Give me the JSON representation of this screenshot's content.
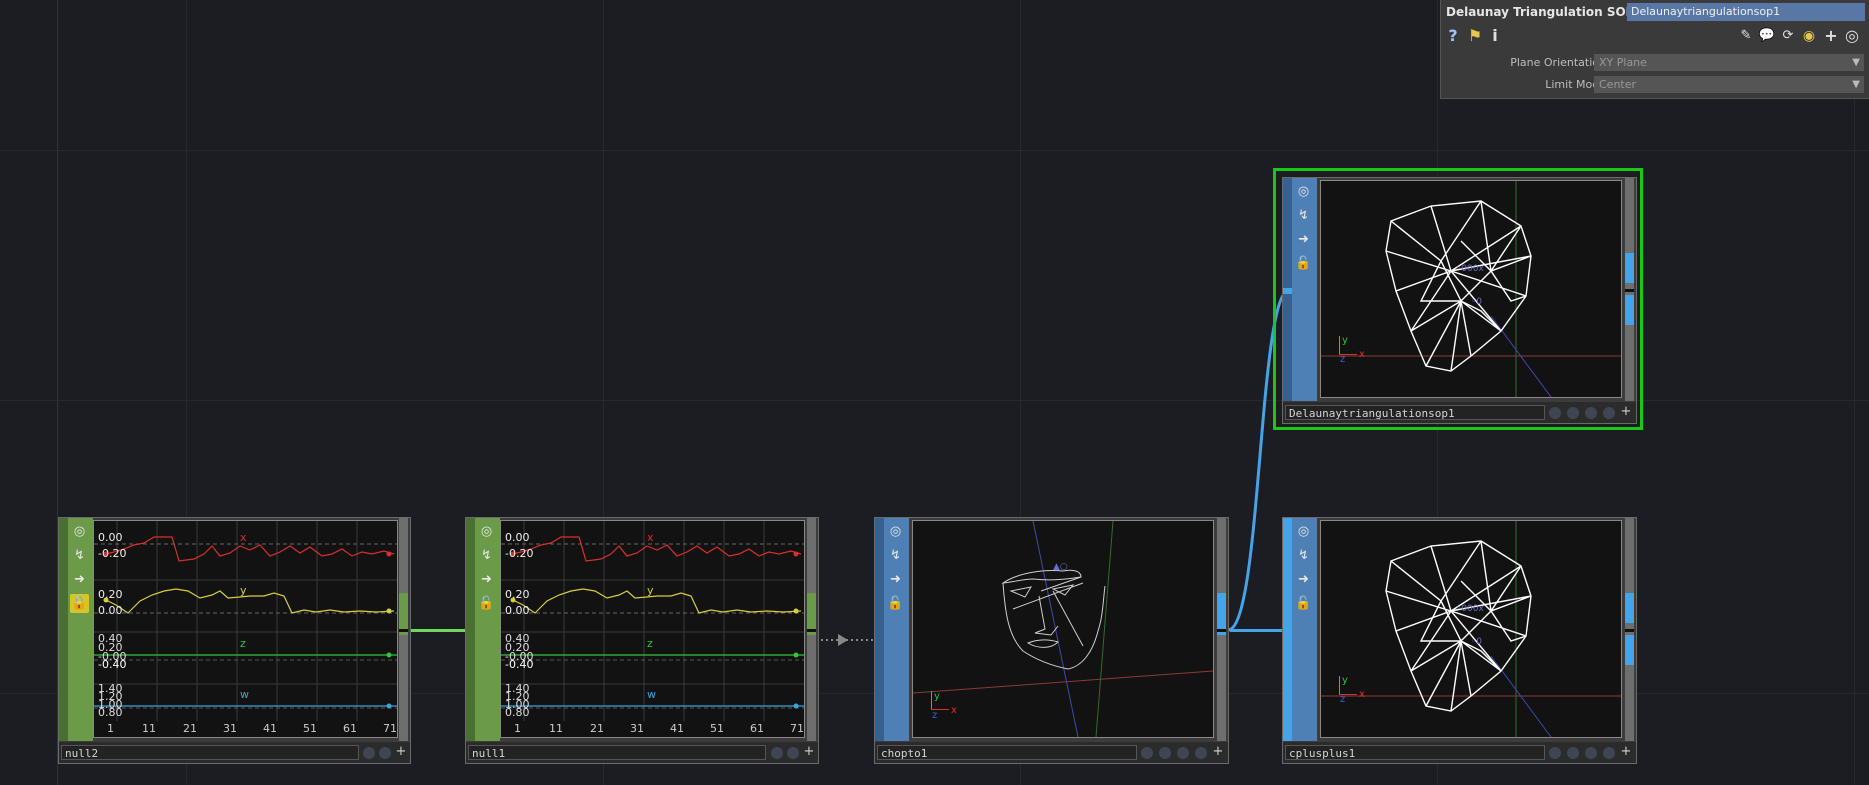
{
  "param_panel": {
    "op_type": "Delaunay Triangulation SOP",
    "op_name": "Delaunaytriangulationsop1",
    "toolbar": {
      "help": "?",
      "info": "i"
    },
    "params": [
      {
        "label": "Plane Orientation",
        "value": "XY Plane"
      },
      {
        "label": "Limit Mode",
        "value": "Center"
      }
    ]
  },
  "nodes": [
    {
      "name": "null2",
      "type": "CHOP",
      "color": "#6b9a49",
      "y_labels": [
        "0.00",
        "-0.20",
        "0.20",
        "0.00",
        "0.40",
        "0.20",
        "-0.00",
        "-0.40",
        "1.40",
        "1.20",
        "1.00",
        "0.80"
      ],
      "x_labels": [
        "1",
        "11",
        "21",
        "31",
        "41",
        "51",
        "61",
        "71"
      ],
      "channels": [
        "x",
        "y",
        "z",
        "w"
      ]
    },
    {
      "name": "null1",
      "type": "CHOP",
      "color": "#6b9a49",
      "y_labels": [
        "0.00",
        "-0.20",
        "0.20",
        "0.00",
        "0.40",
        "0.20",
        "-0.00",
        "-0.40",
        "1.40",
        "1.20",
        "1.00",
        "0.80"
      ],
      "x_labels": [
        "1",
        "11",
        "21",
        "31",
        "41",
        "51",
        "61",
        "71"
      ],
      "channels": [
        "x",
        "y",
        "z",
        "w"
      ]
    },
    {
      "name": "chopto1",
      "type": "SOP",
      "color": "#4e7fb5"
    },
    {
      "name": "cplusplus1",
      "type": "SOP",
      "color": "#4e7fb5"
    },
    {
      "name": "Delaunaytriangulationsop1",
      "type": "SOP",
      "color": "#4e7fb5",
      "selected_color": "#19c919"
    }
  ],
  "channel_colors": {
    "x": "#d8302c",
    "y": "#d7cf3a",
    "z": "#33c63a",
    "w": "#3aa4d9"
  },
  "axis_labels": {
    "x": "x",
    "y": "y",
    "z": "z"
  },
  "wire_colors": {
    "chop": "#72d65d",
    "sop": "#47a3e8"
  }
}
